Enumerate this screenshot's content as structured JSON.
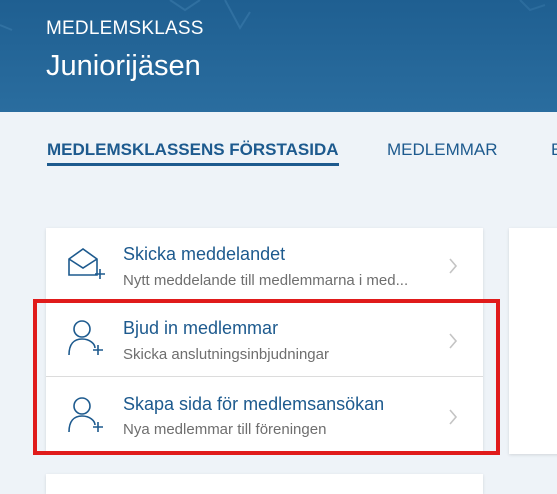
{
  "header": {
    "eyebrow": "MEDLEMSKLASS",
    "title": "Juniorijäsen"
  },
  "tabs": [
    {
      "label": "MEDLEMSKLASSENS FÖRSTASIDA",
      "active": true
    },
    {
      "label": "MEDLEMMAR",
      "active": false
    },
    {
      "label": "E",
      "active": false
    }
  ],
  "actions": [
    {
      "label": "Skicka meddelandet",
      "sub": "Nytt meddelande till medlemmarna i med...",
      "icon": "envelope-plus-icon"
    },
    {
      "label": "Bjud in medlemmar",
      "sub": "Skicka anslutningsinbjudningar",
      "icon": "person-plus-icon"
    },
    {
      "label": "Skapa sida för medlemsansökan",
      "sub": "Nya medlemmar till föreningen",
      "icon": "person-plus-icon"
    }
  ],
  "colors": {
    "header_bg": "#1f5f91",
    "accent": "#1d5a8e",
    "page_bg": "#eef3f8",
    "highlight": "#e01b1b"
  }
}
